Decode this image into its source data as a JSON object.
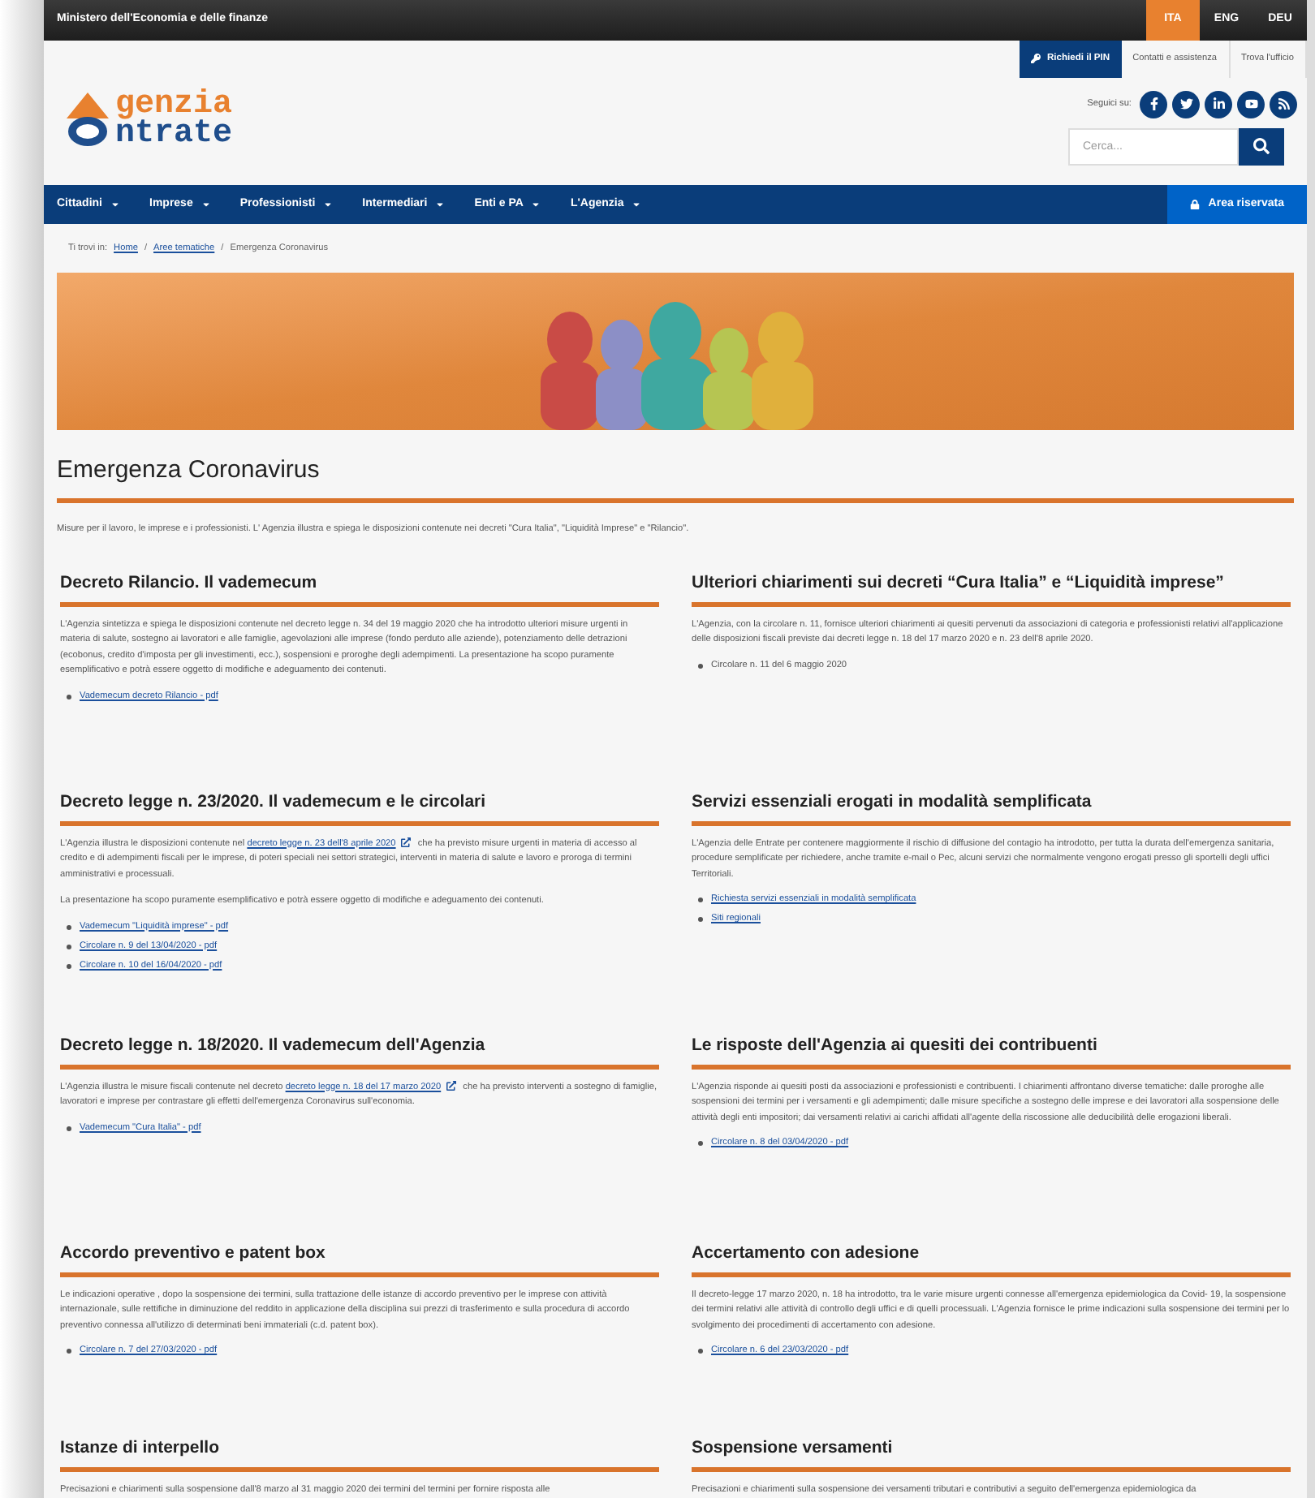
{
  "topbar": {
    "ministry": "Ministero dell'Economia e delle finanze",
    "languages": [
      {
        "label": "ITA",
        "selected": true
      },
      {
        "label": "ENG",
        "selected": false
      },
      {
        "label": "DEU",
        "selected": false
      }
    ]
  },
  "header": {
    "logo_top": "genzia",
    "logo_bottom": "ntrate",
    "pin_button": "Richiedi il PIN",
    "links": [
      "Contatti e assistenza",
      "Trova l'ufficio"
    ],
    "follow_label": "Seguici su:",
    "socials": [
      {
        "kind": "facebook"
      },
      {
        "kind": "twitter"
      },
      {
        "kind": "linkedin"
      },
      {
        "kind": "youtube"
      },
      {
        "kind": "rss"
      }
    ],
    "search": {
      "placeholder": "Cerca..."
    }
  },
  "nav": {
    "items": [
      "Cittadini",
      "Imprese",
      "Professionisti",
      "Intermediari",
      "Enti e PA",
      "L'Agenzia"
    ],
    "reserved": "Area riservata"
  },
  "breadcrumb": {
    "prefix": "Ti trovi in:",
    "separator": "/",
    "items": [
      {
        "label": "Home",
        "link": true
      },
      {
        "label": "Aree tematiche",
        "link": true
      },
      {
        "label": "Emergenza Coronavirus",
        "link": false
      }
    ]
  },
  "title": "Emergenza Coronavirus",
  "intro": "Misure per il lavoro, le imprese e i professionisti. L' Agenzia illustra e spiega le disposizioni contenute nei decreti \"Cura Italia\", \"Liquidità Imprese\" e \"Rilancio\".",
  "sections": [
    {
      "title": "Decreto Rilancio. Il vademecum",
      "paragraphs": [
        [
          {
            "kind": "text",
            "text": "L'Agenzia sintetizza e spiega le disposizioni contenute nel decreto legge n. 34 del 19 maggio 2020 che ha introdotto ulteriori misure urgenti in materia di salute, sostegno ai lavoratori e alle famiglie, agevolazioni alle imprese (fondo perduto alle aziende), potenziamento delle detrazioni (ecobonus, credito d'imposta per gli investimenti, ecc.), sospensioni e proroghe degli adempimenti. La presentazione ha scopo puramente esemplificativo e potrà essere oggetto di modifiche e adeguamento dei contenuti."
          }
        ]
      ],
      "items": [
        {
          "kind": "link",
          "text": "Vademecum decreto Rilancio - pdf"
        }
      ]
    },
    {
      "title": "Ulteriori chiarimenti sui decreti “Cura Italia” e “Liquidità imprese”",
      "paragraphs": [
        [
          {
            "kind": "text",
            "text": "L'Agenzia, con la circolare n. 11, fornisce ulteriori chiarimenti ai quesiti pervenuti da associazioni di categoria e professionisti relativi all'applicazione delle disposizioni fiscali previste dai decreti legge n. 18 del 17 marzo 2020 e n. 23 dell'8 aprile 2020."
          }
        ]
      ],
      "items": [
        {
          "kind": "text",
          "text": "Circolare n. 11 del 6 maggio 2020"
        }
      ]
    },
    {
      "title": "Decreto legge n. 23/2020. Il vademecum e le circolari",
      "paragraphs": [
        [
          {
            "kind": "text",
            "text": "L'Agenzia illustra le disposizioni contenute nel "
          },
          {
            "kind": "external_link",
            "text": "decreto legge n. 23 dell'8 aprile 2020"
          },
          {
            "kind": "text",
            "text": " che ha previsto misure urgenti in materia di accesso al credito e di adempimenti fiscali per le imprese, di poteri speciali nei settori strategici, interventi in materia di salute e lavoro e proroga di termini amministrativi e processuali."
          }
        ],
        [
          {
            "kind": "text",
            "text": "La presentazione ha scopo puramente esemplificativo e potrà essere oggetto di modifiche e adeguamento dei contenuti."
          }
        ]
      ],
      "items": [
        {
          "kind": "link",
          "text": "Vademecum \"Liquidità imprese\" - pdf"
        },
        {
          "kind": "link",
          "text": "Circolare n. 9 del 13/04/2020 - pdf"
        },
        {
          "kind": "link",
          "text": "Circolare n. 10 del 16/04/2020 - pdf"
        }
      ]
    },
    {
      "title": "Servizi essenziali erogati in modalità semplificata",
      "paragraphs": [
        [
          {
            "kind": "text",
            "text": "L'Agenzia delle Entrate per contenere maggiormente il rischio di diffusione del contagio ha introdotto, per tutta la durata dell'emergenza sanitaria, procedure semplificate per richiedere, anche tramite e-mail o Pec, alcuni servizi che normalmente vengono erogati presso gli sportelli degli uffici Territoriali."
          }
        ]
      ],
      "items": [
        {
          "kind": "link",
          "text": "Richiesta servizi essenziali in modalità semplificata"
        },
        {
          "kind": "link",
          "text": "Siti regionali"
        }
      ]
    },
    {
      "title": "Decreto legge n. 18/2020. Il vademecum dell'Agenzia",
      "paragraphs": [
        [
          {
            "kind": "text",
            "text": "L'Agenzia illustra le misure fiscali contenute nel decreto "
          },
          {
            "kind": "external_link",
            "text": "decreto legge n. 18 del 17 marzo 2020"
          },
          {
            "kind": "text",
            "text": " che ha previsto interventi a sostegno di famiglie, lavoratori e imprese per contrastare gli effetti dell'emergenza Coronavirus sull'economia."
          }
        ]
      ],
      "items": [
        {
          "kind": "link",
          "text": "Vademecum \"Cura Italia\" - pdf"
        }
      ]
    },
    {
      "title": "Le risposte dell'Agenzia ai quesiti dei contribuenti",
      "paragraphs": [
        [
          {
            "kind": "text",
            "text": "L'Agenzia risponde ai quesiti posti da associazioni e professionisti e contribuenti. I chiarimenti affrontano diverse tematiche: dalle proroghe alle sospensioni dei termini per i versamenti e gli adempimenti; dalle misure specifiche a sostegno delle imprese e dei lavoratori alla sospensione delle attività degli enti impositori; dai versamenti relativi ai carichi affidati all'agente della riscossione alle deducibilità delle erogazioni liberali."
          }
        ]
      ],
      "items": [
        {
          "kind": "link",
          "text": "Circolare n. 8 del 03/04/2020 - pdf"
        }
      ]
    },
    {
      "title": "Accordo preventivo e patent box",
      "paragraphs": [
        [
          {
            "kind": "text",
            "text": "Le indicazioni operative , dopo la sospensione dei termini, sulla trattazione delle istanze di accordo preventivo per le imprese con attività internazionale, sulle rettifiche in diminuzione del reddito in applicazione della disciplina sui prezzi di trasferimento e sulla procedura di accordo preventivo connessa all'utilizzo di determinati beni immateriali (c.d. patent box)."
          }
        ]
      ],
      "items": [
        {
          "kind": "link",
          "text": "Circolare n. 7 del 27/03/2020 - pdf"
        }
      ]
    },
    {
      "title": "Accertamento con adesione",
      "paragraphs": [
        [
          {
            "kind": "text",
            "text": "Il decreto-legge 17 marzo 2020, n. 18 ha introdotto, tra le varie misure urgenti connesse all'emergenza epidemiologica da Covid- 19, la sospensione dei termini relativi alle attività di controllo degli uffici e di quelli processuali. L'Agenzia fornisce le prime indicazioni sulla sospensione dei termini per lo svolgimento dei procedimenti di accertamento con adesione."
          }
        ]
      ],
      "items": [
        {
          "kind": "link",
          "text": "Circolare n. 6 del 23/03/2020 - pdf"
        }
      ]
    },
    {
      "title": "Istanze di interpello",
      "paragraphs": [
        [
          {
            "kind": "text",
            "text": "Precisazioni e chiarimenti sulla sospensione dall'8 marzo al 31 maggio 2020 dei termini del termini per fornire risposta alle"
          }
        ]
      ]
    },
    {
      "title": "Sospensione versamenti",
      "paragraphs": [
        [
          {
            "kind": "text",
            "text": "Precisazioni e chiarimenti sulla sospensione dei versamenti tributari e contributivi a seguito dell'emergenza epidemiologica da"
          }
        ]
      ]
    }
  ]
}
